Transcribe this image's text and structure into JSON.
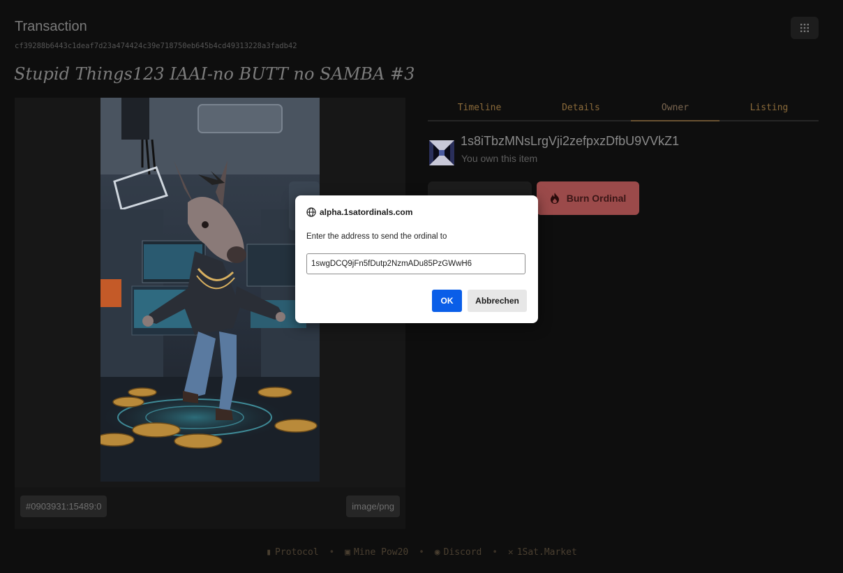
{
  "header": {
    "title": "Transaction",
    "txid": "cf39288b6443c1deaf7d23a474424c39e718750eb645b4cd49313228a3fadb42",
    "menu_icon": "grid-icon"
  },
  "item": {
    "title": "Stupid Things123 IAAI-no BUTT no SAMBA #3",
    "origin": "#0903931:15489:0",
    "content_type": "image/png"
  },
  "tabs": [
    {
      "label": "Timeline"
    },
    {
      "label": "Details"
    },
    {
      "label": "Owner",
      "active": true
    },
    {
      "label": "Listing"
    }
  ],
  "owner": {
    "address": "1s8iTbzMNsLrgVji2zefpxzDfbU9VVkZ1",
    "note": "You own this item"
  },
  "actions": {
    "burn_label": "Burn Ordinal",
    "burn_icon": "fire-icon",
    "burn_color": "#9b4a4a"
  },
  "footer": {
    "links": [
      {
        "label": "Protocol",
        "icon": "book-icon"
      },
      {
        "label": "Mine Pow20",
        "icon": "ticket-icon"
      },
      {
        "label": "Discord",
        "icon": "discord-icon"
      },
      {
        "label": "1Sat.Market",
        "icon": "x-icon"
      }
    ]
  },
  "dialog": {
    "origin": "alpha.1satordinals.com",
    "message": "Enter the address to send the ordinal to",
    "input_value": "1swgDCQ9jFn5fDutp2NzmADu85PzGWwH6",
    "ok_label": "OK",
    "cancel_label": "Abbrechen",
    "ok_color": "#0a5ee8"
  }
}
